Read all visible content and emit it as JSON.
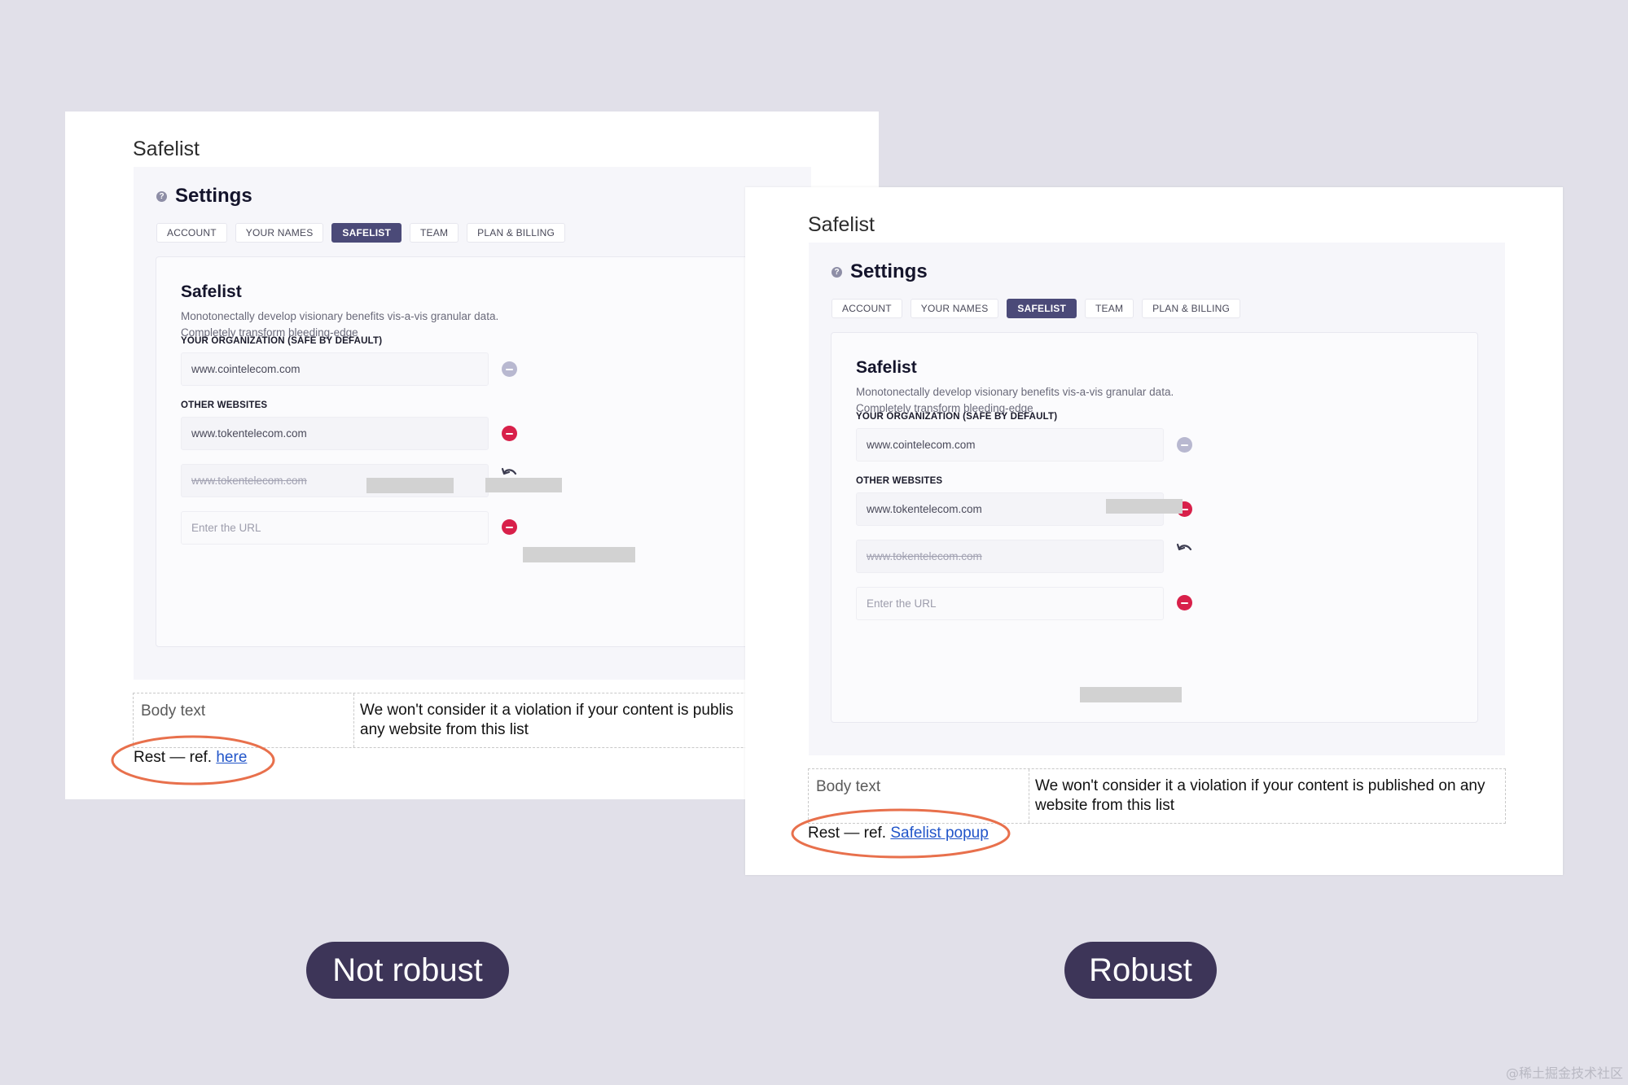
{
  "left_example": {
    "doc_title": "Safelist",
    "settings_title": "Settings",
    "tabs": [
      "ACCOUNT",
      "YOUR NAMES",
      "SAFELIST",
      "TEAM",
      "PLAN & BILLING"
    ],
    "inner_title": "Safelist",
    "inner_desc": "Monotonectally develop visionary benefits vis-a-vis granular data. Completely transform bleeding-edge",
    "org_label": "YOUR ORGANIZATION (SAFE BY DEFAULT)",
    "org_value": "www.cointelecom.com",
    "other_label": "OTHER WEBSITES",
    "site_1": "www.tokentelecom.com",
    "site_2": "www.tokentelecom.com",
    "url_placeholder": "Enter the URL",
    "table_key": "Body text",
    "table_val_line1": "We won't consider it a violation if your content is publis",
    "table_val_line2": "any website from this list",
    "rest_prefix": "Rest — ref.",
    "rest_link": "here"
  },
  "right_example": {
    "doc_title": "Safelist",
    "settings_title": "Settings",
    "tabs": [
      "ACCOUNT",
      "YOUR NAMES",
      "SAFELIST",
      "TEAM",
      "PLAN & BILLING"
    ],
    "inner_title": "Safelist",
    "inner_desc": "Monotonectally develop visionary benefits vis-a-vis granular data. Completely transform bleeding-edge",
    "org_label": "YOUR ORGANIZATION (SAFE BY DEFAULT)",
    "org_value": "www.cointelecom.com",
    "other_label": "OTHER WEBSITES",
    "site_1": "www.tokentelecom.com",
    "site_2": "www.tokentelecom.com",
    "url_placeholder": "Enter the URL",
    "table_key": "Body text",
    "table_val": "We won't consider it a violation if your content is published on any website from this list",
    "rest_prefix": "Rest — ref.",
    "rest_link": "Safelist popup"
  },
  "labels": {
    "left": "Not robust",
    "right": "Robust"
  },
  "watermark": "@稀土掘金技术社区",
  "colors": {
    "background": "#e1e0e9",
    "active_tab": "#4b4a78",
    "remove_icon": "#d8204a",
    "highlight_ellipse": "#e8704c",
    "label_pill": "#3d3558",
    "link": "#2155c9"
  }
}
